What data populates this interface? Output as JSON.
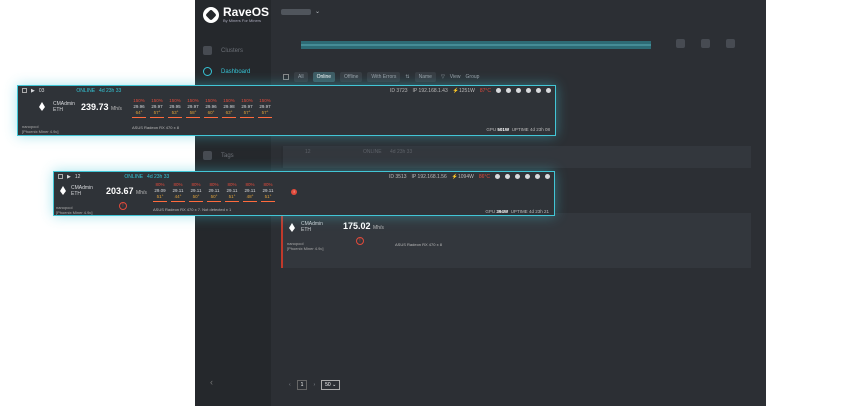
{
  "app": {
    "logo_name": "RaveOS",
    "logo_tag": "By Miners For Miners"
  },
  "sidebar": {
    "items": [
      {
        "label": "Clusters"
      },
      {
        "label": "Dashboard"
      },
      {
        "label": "Tags"
      }
    ],
    "collapse": "‹"
  },
  "filters": {
    "all": "All",
    "online": "Online",
    "offline": "Offline",
    "with_errors": "With Errors",
    "sort": "Name",
    "view": "View",
    "group": "Group"
  },
  "pagination": {
    "page": "1",
    "per_page": "50"
  },
  "back_rows": {
    "row1": {
      "id": "12",
      "status": "ONLINE",
      "uptime": "4d 23h 33"
    },
    "row2": {
      "coin": "CMAdmin",
      "algo": "ETH",
      "hashrate": "175.02",
      "unit": "Mh/s",
      "pool": "nanopool",
      "miner": "[Phoenix Miner 4.9c]",
      "gpu_model": "ASUS Radeon RX 470 x 8"
    }
  },
  "card1": {
    "id": "03",
    "status": "ONLINE",
    "uptime": "4d 23h 33",
    "rig_id": "ID 3723",
    "ip": "IP 192.168.1.43",
    "power": "1251W",
    "temp": "87°C",
    "coin": "CMAdmin",
    "algo": "ETH",
    "hashrate": "239.73",
    "unit": "Mh/s",
    "pool": "nanopool",
    "miner": "[Phoenix Miner 4.9c]",
    "gpu_model": "ASUS Radeon RX 470 x 8",
    "gpu_power_label": "GPU",
    "gpu_power": "501W",
    "uptime_label": "UPTIME",
    "uptime_val": "4d 23h 08",
    "temps": [
      "150%",
      "150%",
      "150%",
      "150%",
      "150%",
      "150%",
      "150%",
      "150%"
    ],
    "rates": [
      "29.96",
      "29.97",
      "29.95",
      "29.97",
      "29.96",
      "29.98",
      "29.97",
      "29.97"
    ],
    "degrees": [
      "64°",
      "57°",
      "53°",
      "58°",
      "60°",
      "63°",
      "57°",
      "57°"
    ]
  },
  "card2": {
    "id": "12",
    "status": "ONLINE",
    "uptime": "4d 23h 33",
    "rig_id": "ID 3513",
    "ip": "IP 192.168.1.56",
    "power": "1094W",
    "temp": "86°C",
    "coin": "CMAdmin",
    "algo": "ETH",
    "hashrate": "203.67",
    "unit": "Mh/s",
    "pool": "nanopool",
    "miner": "[Phoenix Miner 4.9c]",
    "gpu_model": "ASUS Radeon RX 470 x 7. Not detected x 1",
    "gpu_power_label": "GPU",
    "gpu_power": "394W",
    "uptime_label": "UPTIME",
    "uptime_val": "4d 23h 21",
    "temps": [
      "80%",
      "80%",
      "80%",
      "80%",
      "80%",
      "80%",
      "80%"
    ],
    "rates": [
      "29.09",
      "29.11",
      "29.11",
      "29.11",
      "29.11",
      "29.11",
      "29.11"
    ],
    "degrees": [
      "51°",
      "44°",
      "50°",
      "50°",
      "51°",
      "48°",
      "51°"
    ]
  },
  "colors": {
    "accent": "#37c4d6",
    "error": "#e24a3b",
    "warning": "#e0a23a"
  }
}
